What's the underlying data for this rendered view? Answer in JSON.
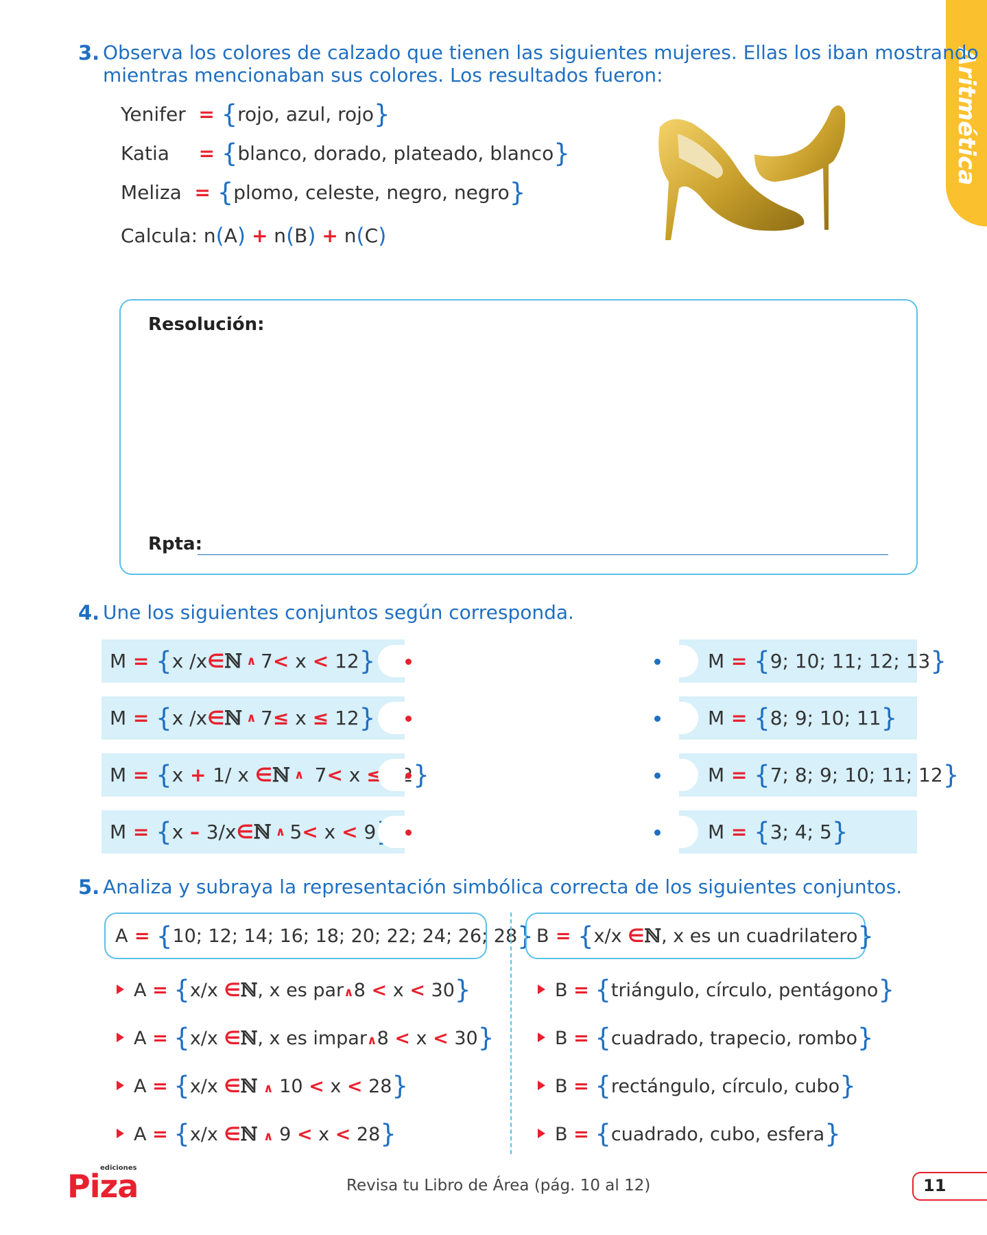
{
  "side_tab": "Aritmética",
  "q3": {
    "number": "3.",
    "text_line1": "Observa los colores de calzado que tienen las siguientes mujeres. Ellas los iban mostrando",
    "text_line2": "mientras mencionaban sus colores. Los resultados fueron:",
    "rows": [
      {
        "name": "Yenifer",
        "items": "rojo, azul, rojo"
      },
      {
        "name": "Katia",
        "items": "blanco, dorado, plateado, blanco"
      },
      {
        "name": "Meliza",
        "items": "plomo, celeste, negro, negro"
      }
    ],
    "calc_label": "Calcula:",
    "image_alt": "gold-glitter-high-heels",
    "resolution_label": "Resolución:",
    "answer_label": "Rpta:"
  },
  "q4": {
    "number": "4.",
    "text": "Une los siguientes conjuntos según corresponda.",
    "right": [
      "9; 10; 11; 12; 13",
      "8; 9; 10; 11",
      "7; 8; 9; 10; 11; 12",
      "3; 4; 5"
    ]
  },
  "q5": {
    "number": "5.",
    "text": "Analiza y subraya la representación simbólica correcta de los siguientes conjuntos.",
    "set_a": "10; 12; 14; 16; 18; 20; 22; 24; 26; 28",
    "set_b": "x/x",
    "set_b_tail": ", x es un cuadrilatero",
    "b_options": [
      "triángulo, círculo, pentágono",
      "cuadrado, trapecio, rombo",
      "rectángulo, círculo, cubo",
      "cuadrado, cubo, esfera"
    ]
  },
  "footer": {
    "text": "Revisa tu Libro de Área (pág. 10 al 12)",
    "page": "11",
    "logo": "Piza",
    "logo_small": "ediciones"
  },
  "colors": {
    "blue": "#1f6fc1",
    "red": "#e8212e",
    "cyan": "#5bc0e8",
    "light_blue_fill": "#d7f0f9",
    "yellow": "#fbc02d"
  }
}
